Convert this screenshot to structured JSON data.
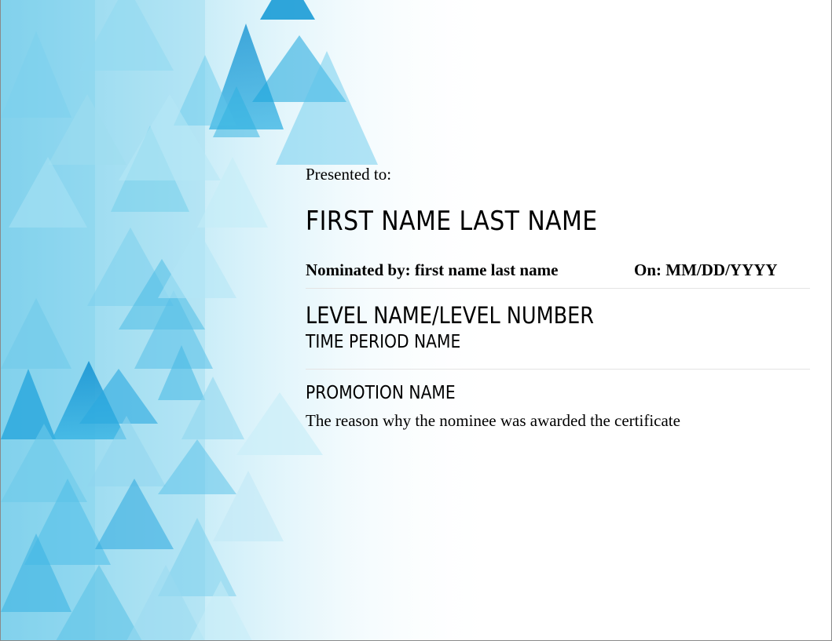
{
  "certificate": {
    "presented_label": "Presented to:",
    "recipient_name": "FIRST NAME LAST NAME",
    "nominated_by": "Nominated by: first name last name",
    "on_date": "On: MM/DD/YYYY",
    "level": "LEVEL NAME/LEVEL NUMBER",
    "time_period": "TIME PERIOD NAME",
    "promotion": "PROMOTION NAME",
    "reason": "The reason why the nominee was awarded the certificate"
  },
  "theme": {
    "accent_light": "#9fdcef",
    "accent_mid": "#3fb4dc",
    "accent_dark": "#0a8ccf",
    "background": "#ffffff"
  }
}
